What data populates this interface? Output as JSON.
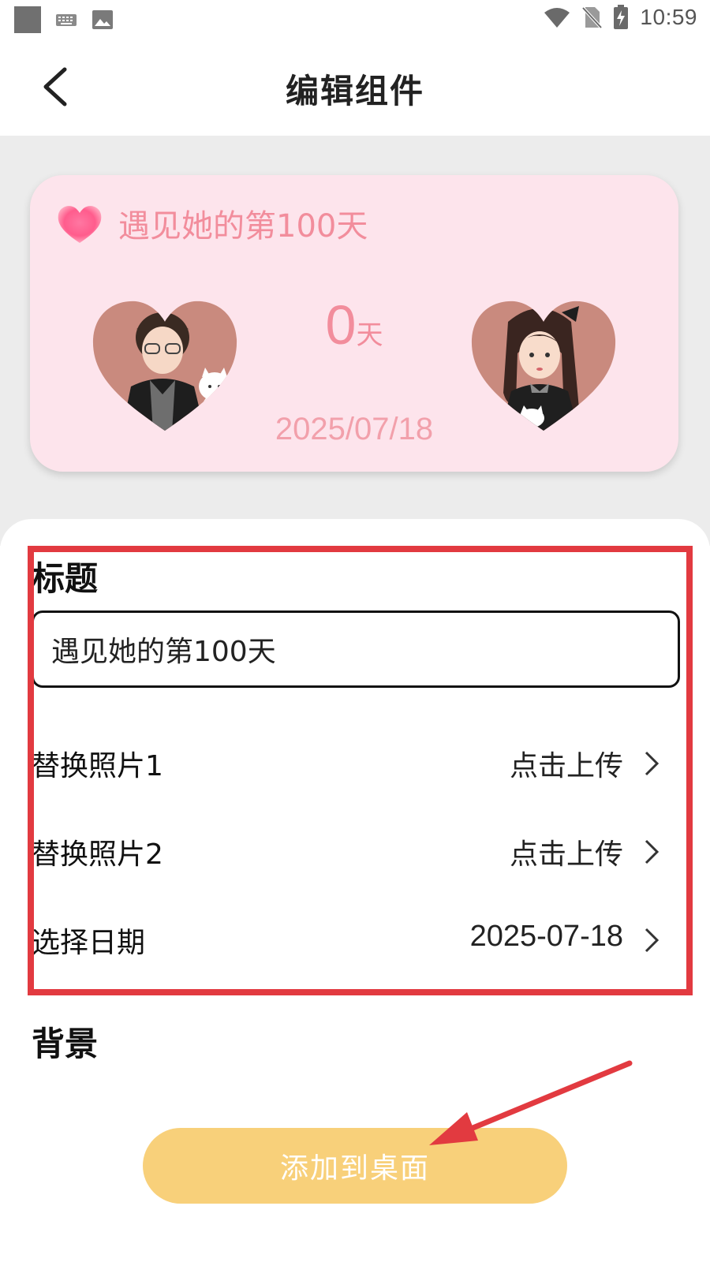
{
  "status_bar": {
    "time": "10:59",
    "icons": [
      "app-square-icon",
      "keyboard-icon",
      "gallery-icon",
      "wifi-icon",
      "no-sim-icon",
      "battery-charging-icon"
    ]
  },
  "app_bar": {
    "title": "编辑组件",
    "back_icon": "chevron-left-icon"
  },
  "widget_preview": {
    "title": "遇见她的第100天",
    "count": "0",
    "count_unit": "天",
    "date": "2025/07/18",
    "accent_color": "#f28d9c",
    "background_color": "#fde4ec"
  },
  "form": {
    "title_section_label": "标题",
    "title_input_value": "遇见她的第100天",
    "rows": [
      {
        "label": "替换照片1",
        "value": "点击上传"
      },
      {
        "label": "替换照片2",
        "value": "点击上传"
      },
      {
        "label": "选择日期",
        "value": "2025-07-18"
      }
    ],
    "background_section_label": "背景"
  },
  "actions": {
    "add_to_desktop_label": "添加到桌面",
    "button_color": "#f8d07a"
  },
  "annotations": {
    "highlight_color": "#e23a40"
  }
}
